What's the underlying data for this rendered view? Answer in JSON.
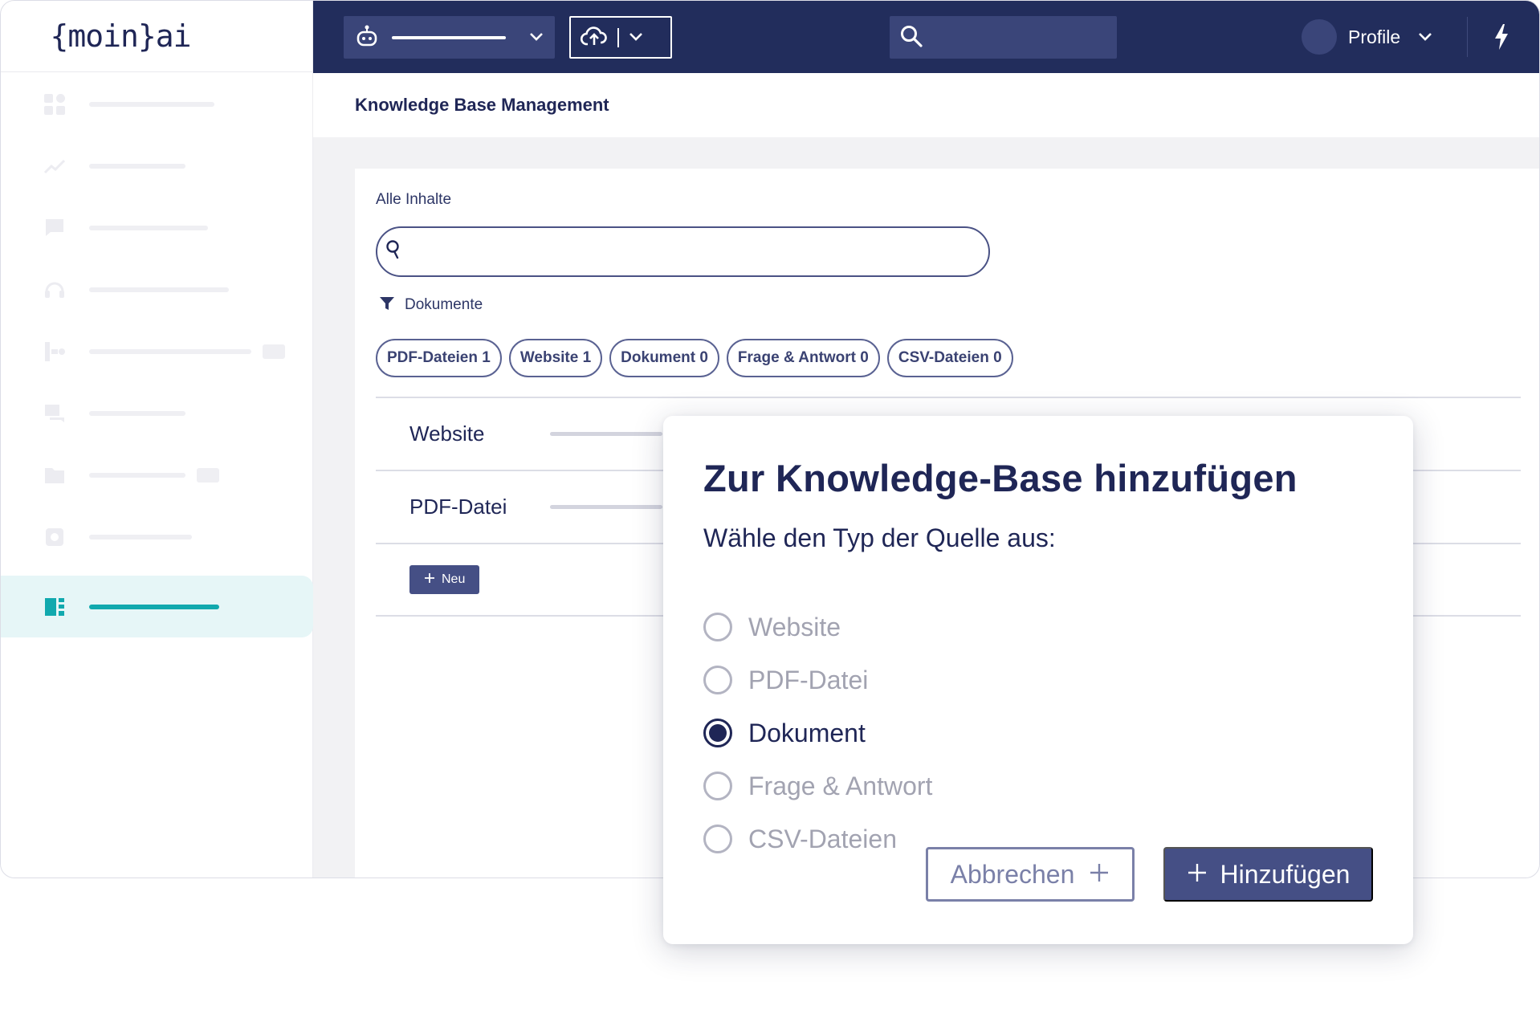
{
  "logo": {
    "text": "{moin}ai"
  },
  "topbar": {
    "profile_label": "Profile"
  },
  "page": {
    "title": "Knowledge Base Management"
  },
  "content": {
    "section_label": "Alle Inhalte",
    "search_value": "",
    "filter_label": "Dokumente",
    "chips": [
      {
        "label": "PDF-Dateien 1"
      },
      {
        "label": "Website 1"
      },
      {
        "label": "Dokument 0"
      },
      {
        "label": "Frage & Antwort 0"
      },
      {
        "label": "CSV-Dateien 0"
      }
    ],
    "rows": [
      {
        "label": "Website"
      },
      {
        "label": "PDF-Datei"
      }
    ],
    "new_button_label": "Neu"
  },
  "modal": {
    "title": "Zur Knowledge-Base hinzufügen",
    "subtitle": "Wähle den Typ der Quelle aus:",
    "options": [
      {
        "label": "Website",
        "selected": false
      },
      {
        "label": "PDF-Datei",
        "selected": false
      },
      {
        "label": "Dokument",
        "selected": true
      },
      {
        "label": "Frage & Antwort",
        "selected": false
      },
      {
        "label": "CSV-Dateien",
        "selected": false
      }
    ],
    "cancel_label": "Abbrechen",
    "add_label": "Hinzufügen"
  },
  "colors": {
    "topbar_bg": "#222d5c",
    "accent_teal": "#11a9ae",
    "primary_button": "#454f85",
    "text_dark": "#1f2656"
  },
  "icons": {
    "sidebar": [
      "dashboard-icon",
      "analytics-icon",
      "messages-icon",
      "support-icon",
      "flow-icon",
      "chat-icon",
      "folder-icon",
      "settings-icon",
      "knowledge-base-icon"
    ],
    "topbar": [
      "robot-icon",
      "chevron-down-icon",
      "cloud-upload-icon",
      "search-icon",
      "bolt-icon"
    ]
  }
}
